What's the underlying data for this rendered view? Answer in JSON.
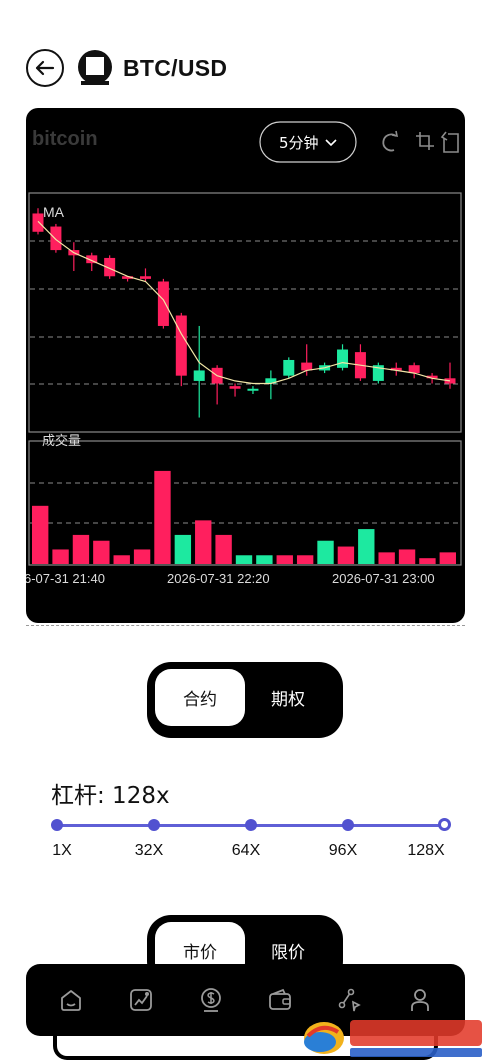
{
  "header": {
    "title": "BTC/USD"
  },
  "chart": {
    "watermark": "bitcoin",
    "interval_label": "5分钟",
    "ma_label": "MA",
    "volume_label": "成交量",
    "time_labels": [
      "6-07-31 21:40",
      "2026-07-31 22:20",
      "2026-07-31 23:00"
    ],
    "colors": {
      "up": "#1de9a0",
      "down": "#ff1f5e",
      "ma": "#f2e6a6",
      "grid": "#8a8a8a"
    }
  },
  "chart_data": {
    "type": "candlestick",
    "candles": [
      {
        "o": 100,
        "c": 93,
        "h": 102,
        "l": 92
      },
      {
        "o": 95,
        "c": 86,
        "h": 96,
        "l": 85
      },
      {
        "o": 86,
        "c": 84,
        "h": 89,
        "l": 78
      },
      {
        "o": 84,
        "c": 81,
        "h": 85,
        "l": 78
      },
      {
        "o": 83,
        "c": 76,
        "h": 84,
        "l": 75
      },
      {
        "o": 76,
        "c": 75,
        "h": 76,
        "l": 74
      },
      {
        "o": 76,
        "c": 75,
        "h": 79,
        "l": 74
      },
      {
        "o": 74,
        "c": 57,
        "h": 75,
        "l": 56
      },
      {
        "o": 61,
        "c": 38,
        "h": 62,
        "l": 34
      },
      {
        "o": 36,
        "c": 40,
        "h": 57,
        "l": 22
      },
      {
        "o": 41,
        "c": 35,
        "h": 42,
        "l": 27
      },
      {
        "o": 34,
        "c": 33,
        "h": 35,
        "l": 30
      },
      {
        "o": 33,
        "c": 33,
        "h": 34,
        "l": 31
      },
      {
        "o": 35,
        "c": 37,
        "h": 40,
        "l": 29
      },
      {
        "o": 38,
        "c": 44,
        "h": 45,
        "l": 37
      },
      {
        "o": 43,
        "c": 40,
        "h": 50,
        "l": 38
      },
      {
        "o": 40,
        "c": 42,
        "h": 43,
        "l": 39
      },
      {
        "o": 41,
        "c": 48,
        "h": 50,
        "l": 40
      },
      {
        "o": 47,
        "c": 37,
        "h": 50,
        "l": 36
      },
      {
        "o": 36,
        "c": 42,
        "h": 43,
        "l": 35
      },
      {
        "o": 41,
        "c": 40,
        "h": 43,
        "l": 38
      },
      {
        "o": 42,
        "c": 39,
        "h": 43,
        "l": 37
      },
      {
        "o": 38,
        "c": 37,
        "h": 39,
        "l": 35
      },
      {
        "o": 37,
        "c": 35,
        "h": 43,
        "l": 33
      }
    ],
    "ma": [
      97,
      90,
      85,
      82,
      79,
      76,
      74,
      67,
      54,
      43,
      38,
      36,
      35,
      35,
      37,
      40,
      41,
      43,
      42,
      41,
      40,
      39,
      37,
      36
    ],
    "volumes": [
      20,
      5,
      10,
      8,
      3,
      5,
      32,
      10,
      15,
      10,
      3,
      3,
      3,
      3,
      8,
      6,
      12,
      4,
      5,
      2,
      4
    ],
    "vol_dir": [
      "down",
      "down",
      "down",
      "down",
      "down",
      "down",
      "down",
      "up",
      "down",
      "down",
      "up",
      "up",
      "down",
      "down",
      "up",
      "down",
      "up",
      "down",
      "down",
      "down",
      "down"
    ]
  },
  "contract_toggle": {
    "active": "合约",
    "inactive": "期权"
  },
  "leverage": {
    "label": "杠杆: 128x",
    "stops": [
      "1X",
      "32X",
      "64X",
      "96X",
      "128X"
    ],
    "value_fraction": 1.0
  },
  "order_toggle": {
    "active": "市价",
    "inactive": "限价"
  },
  "nav": {
    "items": [
      "home-icon",
      "chart-icon",
      "coin-icon",
      "wallet-icon",
      "share-icon",
      "profile-icon"
    ]
  }
}
